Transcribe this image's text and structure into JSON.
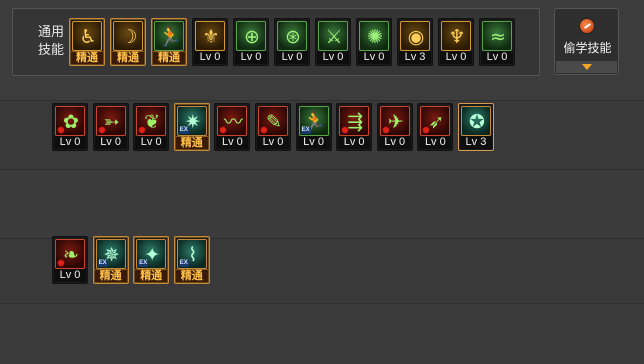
{
  "common": {
    "label": "通用\n技能",
    "skills": [
      {
        "name": "skill-sit",
        "glyph": "♿",
        "color": "gold",
        "level": "精通",
        "master": true
      },
      {
        "name": "skill-stealth-gold",
        "glyph": "☽",
        "color": "gold",
        "level": "精通",
        "master": true
      },
      {
        "name": "skill-dash-green",
        "glyph": "🏃",
        "color": "green",
        "level": "精通",
        "master": true
      },
      {
        "name": "skill-wing",
        "glyph": "⚜",
        "color": "gold",
        "level": "Lv 0",
        "master": false
      },
      {
        "name": "skill-target",
        "glyph": "⊕",
        "color": "green",
        "level": "Lv 0",
        "master": false
      },
      {
        "name": "skill-crosshair",
        "glyph": "⊛",
        "color": "green",
        "level": "Lv 0",
        "master": false
      },
      {
        "name": "skill-throw",
        "glyph": "⚔",
        "color": "green",
        "level": "Lv 0",
        "master": false
      },
      {
        "name": "skill-cloud",
        "glyph": "✺",
        "color": "green",
        "level": "Lv 0",
        "master": false
      },
      {
        "name": "skill-eye",
        "glyph": "◉",
        "color": "gold",
        "level": "Lv 3",
        "master": false
      },
      {
        "name": "skill-aura",
        "glyph": "♆",
        "color": "gold",
        "level": "Lv 0",
        "master": false
      },
      {
        "name": "skill-twist",
        "glyph": "≈",
        "color": "green",
        "level": "Lv 0",
        "master": false
      }
    ]
  },
  "learn_button": {
    "label": "偷学技能",
    "icon": "steal-skill-icon"
  },
  "row1": {
    "skills": [
      {
        "name": "skill-r1-1",
        "glyph": "✿",
        "color": "red",
        "level": "Lv 0",
        "badge": "red"
      },
      {
        "name": "skill-r1-2",
        "glyph": "➳",
        "color": "red",
        "level": "Lv 0",
        "badge": "red"
      },
      {
        "name": "skill-r1-3",
        "glyph": "❦",
        "color": "red",
        "level": "Lv 0",
        "badge": "red"
      },
      {
        "name": "skill-r1-4",
        "glyph": "✷",
        "color": "teal",
        "level": "精通",
        "badge": "ex",
        "master": true
      },
      {
        "name": "skill-r1-5",
        "glyph": "〰",
        "color": "red",
        "level": "Lv 0",
        "badge": "red"
      },
      {
        "name": "skill-r1-6",
        "glyph": "✎",
        "color": "red",
        "level": "Lv 0",
        "badge": "red"
      },
      {
        "name": "skill-r1-7",
        "glyph": "🏃",
        "color": "green",
        "level": "Lv 0",
        "badge": "ex"
      },
      {
        "name": "skill-r1-8",
        "glyph": "⇶",
        "color": "red",
        "level": "Lv 0",
        "badge": "red"
      },
      {
        "name": "skill-r1-9",
        "glyph": "✈",
        "color": "red",
        "level": "Lv 0",
        "badge": "red"
      },
      {
        "name": "skill-r1-10",
        "glyph": "➶",
        "color": "red",
        "level": "Lv 0",
        "badge": "red"
      },
      {
        "name": "skill-r1-11",
        "glyph": "✪",
        "color": "teal",
        "level": "Lv 3",
        "badge": "none",
        "gold": true
      }
    ]
  },
  "row3": {
    "skills": [
      {
        "name": "skill-r3-1",
        "glyph": "❧",
        "color": "red",
        "level": "Lv 0",
        "badge": "red"
      },
      {
        "name": "skill-r3-2",
        "glyph": "✵",
        "color": "teal",
        "level": "精通",
        "badge": "ex",
        "master": true
      },
      {
        "name": "skill-r3-3",
        "glyph": "✦",
        "color": "teal",
        "level": "精通",
        "badge": "ex",
        "master": true
      },
      {
        "name": "skill-r3-4",
        "glyph": "⌇",
        "color": "teal",
        "level": "精通",
        "badge": "ex",
        "master": true
      }
    ]
  }
}
